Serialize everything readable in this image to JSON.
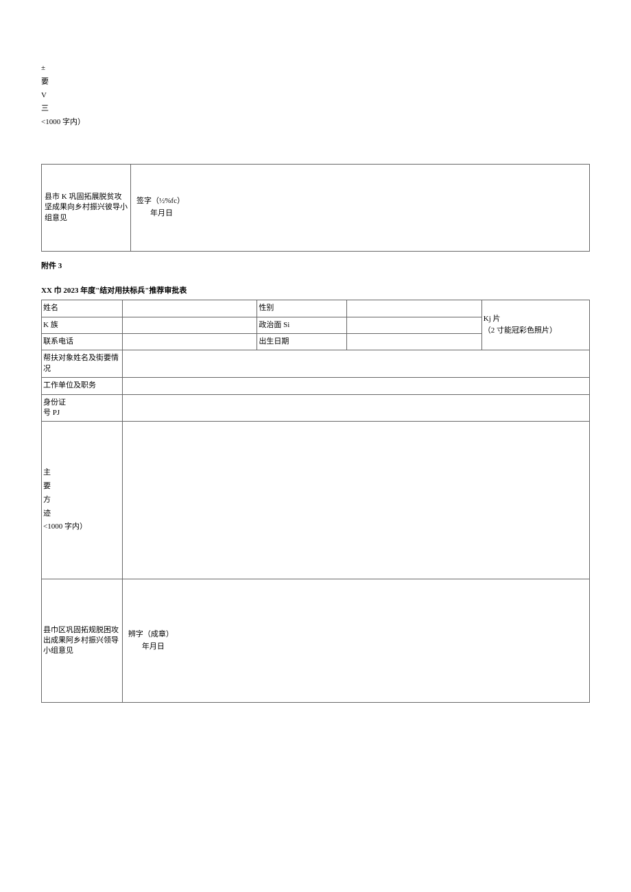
{
  "top": {
    "l1": "±",
    "l2": "要",
    "l3": "V",
    "l4": "三",
    "l5": "<1000 字内）"
  },
  "table1": {
    "label": "县市 K 巩固拓展脱贫攻坚成果向乡村振兴彼导小组意见",
    "sig1": "签字（½%fc）",
    "sig2": "年月日"
  },
  "attachment": "附件 3",
  "formTitle": "XX 巾 2023 年度\"结对用扶标兵\"推荐审批表",
  "table2": {
    "row1": {
      "label1": "姓名",
      "label2": "性别"
    },
    "row2": {
      "label1": "K 族",
      "label2": "政治面 Si"
    },
    "row3": {
      "label1": "联系电话",
      "label2": "出生日期"
    },
    "photo": {
      "l1": "Kj 片",
      "l2": "（2 寸能冠彩色照片）"
    },
    "row4": {
      "label": "帮扶对象姓名及街要情况"
    },
    "row5": {
      "label": "工作单位及职务"
    },
    "row6": {
      "l1": "身份证",
      "l2": "号 PJ"
    },
    "methods": {
      "l1": "主",
      "l2": "要",
      "l3": "方",
      "l4": "迹",
      "l5": "<1000 字内）"
    },
    "opinion": {
      "label": "县巾区巩固拓规脱困攻出成果阿乡村振兴领导小组意见",
      "sig1": "辨字（成章）",
      "sig2": "年月日"
    }
  }
}
